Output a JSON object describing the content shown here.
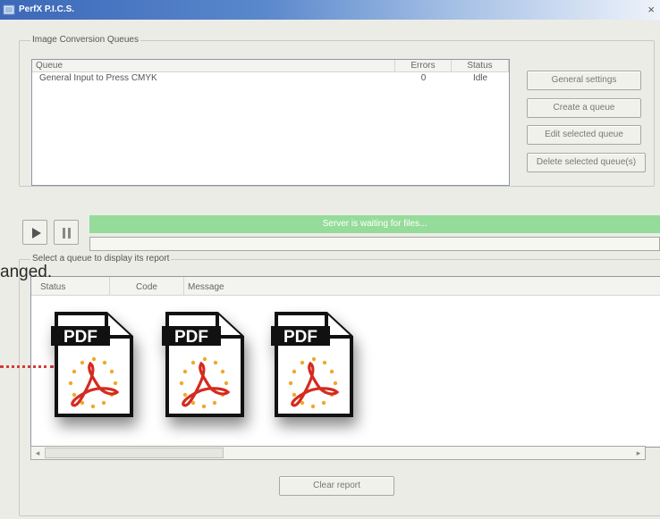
{
  "window": {
    "title": "PerfX P.I.C.S.",
    "close": "×"
  },
  "queues": {
    "group_label": "Image Conversion Queues",
    "columns": [
      "Queue",
      "Errors",
      "Status"
    ],
    "rows": [
      {
        "queue": "General Input to Press CMYK",
        "errors": "0",
        "status": "Idle"
      }
    ]
  },
  "buttons": {
    "general_settings": "General settings",
    "create_queue": "Create a queue",
    "edit_queue": "Edit selected queue",
    "delete_queue": "Delete selected queue(s)",
    "clear_report": "Clear report"
  },
  "server": {
    "status_text": "Server is waiting for files..."
  },
  "report": {
    "group_label": "Select a queue to display its report",
    "columns": [
      "Status",
      "Code",
      "Message"
    ]
  },
  "overlay": {
    "text": "anged."
  },
  "pdf_icons": [
    {
      "label": "PDF"
    },
    {
      "label": "PDF"
    },
    {
      "label": "PDF"
    }
  ],
  "colors": {
    "status_bar": "#95dc9a",
    "titlebar": "#3c68b8",
    "dotted_line": "#d63a3a",
    "pdf_acrobat_red": "#d42b1f"
  },
  "icons": {
    "play": "play-icon",
    "pause": "pause-icon",
    "scroll_left": "arrow-left-icon",
    "scroll_right": "arrow-right-icon"
  }
}
